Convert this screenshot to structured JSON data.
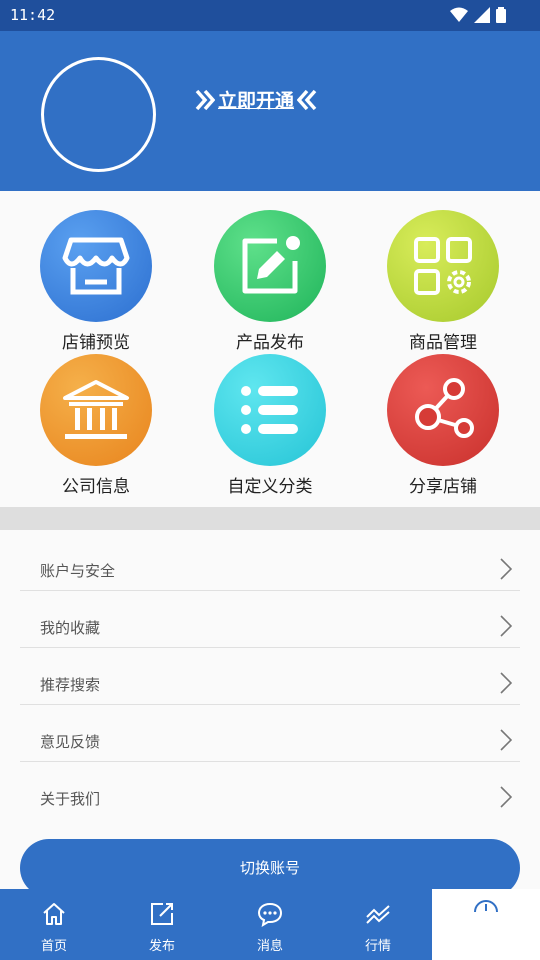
{
  "status_bar": {
    "time": "11:42"
  },
  "header": {
    "open_label": "立即开通"
  },
  "grid": [
    {
      "label": "店铺预览"
    },
    {
      "label": "产品发布"
    },
    {
      "label": "商品管理"
    },
    {
      "label": "公司信息"
    },
    {
      "label": "自定义分类"
    },
    {
      "label": "分享店铺"
    }
  ],
  "menu": [
    {
      "label": "账户与安全"
    },
    {
      "label": "我的收藏"
    },
    {
      "label": "推荐搜索"
    },
    {
      "label": "意见反馈"
    },
    {
      "label": "关于我们"
    }
  ],
  "switch_account_label": "切换账号",
  "tabs": [
    {
      "label": "首页",
      "icon": "home-icon"
    },
    {
      "label": "发布",
      "icon": "edit-icon"
    },
    {
      "label": "消息",
      "icon": "message-icon"
    },
    {
      "label": "行情",
      "icon": "chart-icon"
    },
    {
      "label": "",
      "icon": "profile-icon"
    }
  ],
  "colors": {
    "primary": "#3170c5",
    "statusbar": "#1f4f9c"
  }
}
